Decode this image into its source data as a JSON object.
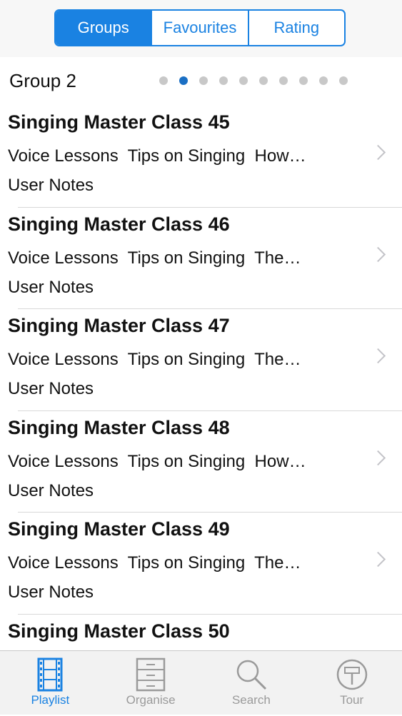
{
  "segmented": {
    "options": [
      "Groups",
      "Favourites",
      "Rating"
    ],
    "selected": "Groups"
  },
  "group": {
    "title": "Group 2",
    "page_dots": 10,
    "current_page": 2
  },
  "rows": [
    {
      "title": "Singing Master Class 45",
      "subtitle": "Voice Lessons  Tips on Singing  How…",
      "notes": "User Notes"
    },
    {
      "title": "Singing Master Class 46",
      "subtitle": "Voice Lessons  Tips on Singing  The…",
      "notes": "User Notes"
    },
    {
      "title": "Singing Master Class 47",
      "subtitle": "Voice Lessons  Tips on Singing  The…",
      "notes": "User Notes"
    },
    {
      "title": "Singing Master Class 48",
      "subtitle": "Voice Lessons  Tips on Singing  How…",
      "notes": "User Notes"
    },
    {
      "title": "Singing Master Class 49",
      "subtitle": "Voice Lessons  Tips on Singing  The…",
      "notes": "User Notes"
    },
    {
      "title": "Singing Master Class 50"
    }
  ],
  "tabbar": {
    "tabs": [
      {
        "label": "Playlist",
        "icon": "film-strip-icon"
      },
      {
        "label": "Organise",
        "icon": "cabinet-icon"
      },
      {
        "label": "Search",
        "icon": "search-icon"
      },
      {
        "label": "Tour",
        "icon": "tour-sign-icon"
      }
    ],
    "selected": "Playlist"
  },
  "colors": {
    "accent": "#1a82e2",
    "inactive_tab": "#9a9a9a",
    "chevron": "#c3c3c8"
  }
}
